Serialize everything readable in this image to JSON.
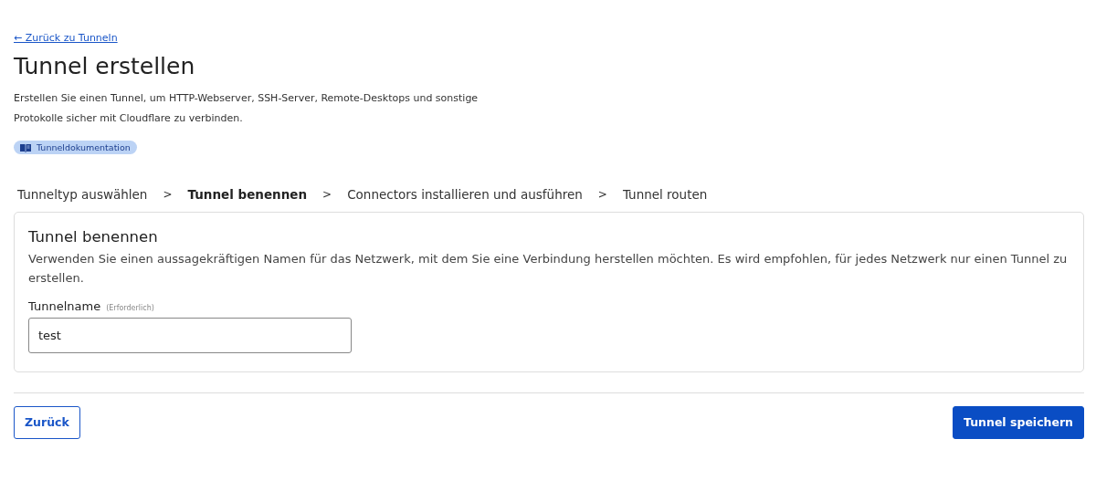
{
  "back_link": "← Zurück zu Tunneln",
  "title": "Tunnel erstellen",
  "description": "Erstellen Sie einen Tunnel, um HTTP-Webserver, SSH-Server, Remote-Desktops und sonstige Protokolle sicher mit Cloudflare zu verbinden.",
  "doc_badge": "Tunneldokumentation",
  "steps": [
    {
      "label": "Tunneltyp auswählen",
      "selected": false
    },
    {
      "label": "Tunnel benennen",
      "selected": true
    },
    {
      "label": "Connectors installieren und ausführen",
      "selected": false
    },
    {
      "label": "Tunnel routen",
      "selected": false
    }
  ],
  "step_separators": [
    ">",
    ">",
    ">"
  ],
  "card": {
    "title": "Tunnel benennen",
    "text": "Verwenden Sie einen aussagekräftigen Namen für das Netzwerk, mit dem Sie eine Verbindung herstellen möchten. Es wird empfohlen, für jedes Netzwerk nur einen Tunnel zu erstellen.",
    "field_label": "Tunnelname",
    "field_hint": "(Erforderlich)",
    "field_value": "test"
  },
  "buttons": {
    "back": "Zurück",
    "save": "Tunnel speichern"
  }
}
